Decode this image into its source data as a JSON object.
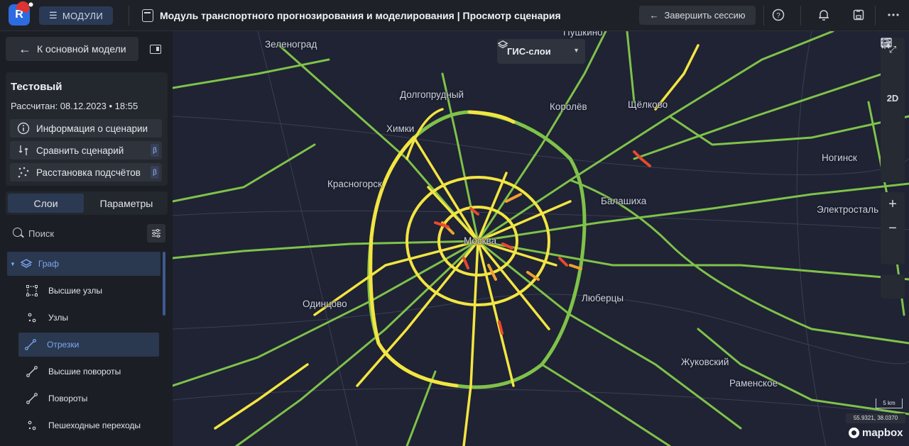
{
  "topbar": {
    "logo_letter": "R",
    "modules_label": "МОДУЛИ",
    "title": "Модуль транспортного прогнозирования и моделирования | Просмотр сценария",
    "end_session_label": "Завершить сессию",
    "icons": [
      "help-icon",
      "notifications-icon",
      "save-icon",
      "more-icon"
    ]
  },
  "sidebar": {
    "back_label": "К основной модели",
    "scenario": {
      "name": "Тестовый",
      "calculated": "Рассчитан: 08.12.2023 • 18:55",
      "buttons": [
        {
          "label": "Информация о сценарии",
          "icon": "info-icon",
          "beta": ""
        },
        {
          "label": "Сравнить сценарий",
          "icon": "compare-icon",
          "beta": "β"
        },
        {
          "label": "Расстановка подсчётов",
          "icon": "points-icon",
          "beta": "β"
        }
      ]
    },
    "tabs": [
      {
        "label": "Слои",
        "active": true
      },
      {
        "label": "Параметры",
        "active": false
      }
    ],
    "search": {
      "placeholder": "Поиск"
    },
    "layers": [
      {
        "label": "Граф",
        "icon": "layers-icon",
        "group": true,
        "active": true
      },
      {
        "label": "Высшие узлы",
        "icon": "selection-icon",
        "active": false
      },
      {
        "label": "Узлы",
        "icon": "nodes-icon",
        "active": false
      },
      {
        "label": "Отрезки",
        "icon": "segment-icon",
        "active": true
      },
      {
        "label": "Высшие повороты",
        "icon": "segment-icon",
        "active": false
      },
      {
        "label": "Повороты",
        "icon": "segment-icon",
        "active": false
      },
      {
        "label": "Пешеходные переходы",
        "icon": "nodes-icon",
        "active": false
      }
    ]
  },
  "map": {
    "gis_label": "ГИС-слои",
    "tools_top": [
      "fullscreen-icon",
      "layers-icon",
      "2D",
      "compass-icon",
      "image-icon",
      "person-icon"
    ],
    "tools_bottom": [
      "zoom-in-icon",
      "zoom-out-icon",
      "location-icon",
      "legend-icon"
    ],
    "scale": "5 km",
    "coords": "55.9321, 38.0370",
    "attribution": "mapbox",
    "labels": {
      "zelenograd": "Зеленоград",
      "pushkino": "Пушкино",
      "dolgoprudny": "Долгопрудный",
      "korolev": "Королёв",
      "shchelkovo": "Щёлково",
      "khimki": "Химки",
      "noginsk": "Ногинск",
      "krasnogorsk": "Красногорск",
      "balashikha": "Балашиха",
      "elektrostal": "Электросталь",
      "moskva": "Москва",
      "odintsovo": "Одинцово",
      "lyubertsy": "Люберцы",
      "zhukovsky": "Жуковский",
      "ramenskoe": "Раменское"
    },
    "colors": {
      "background": "#1f2333",
      "road_green": "#7fc24a",
      "road_yellow": "#f3e542",
      "road_orange": "#f0a030",
      "road_red": "#e8492e",
      "accent": "#2b3a52"
    }
  }
}
